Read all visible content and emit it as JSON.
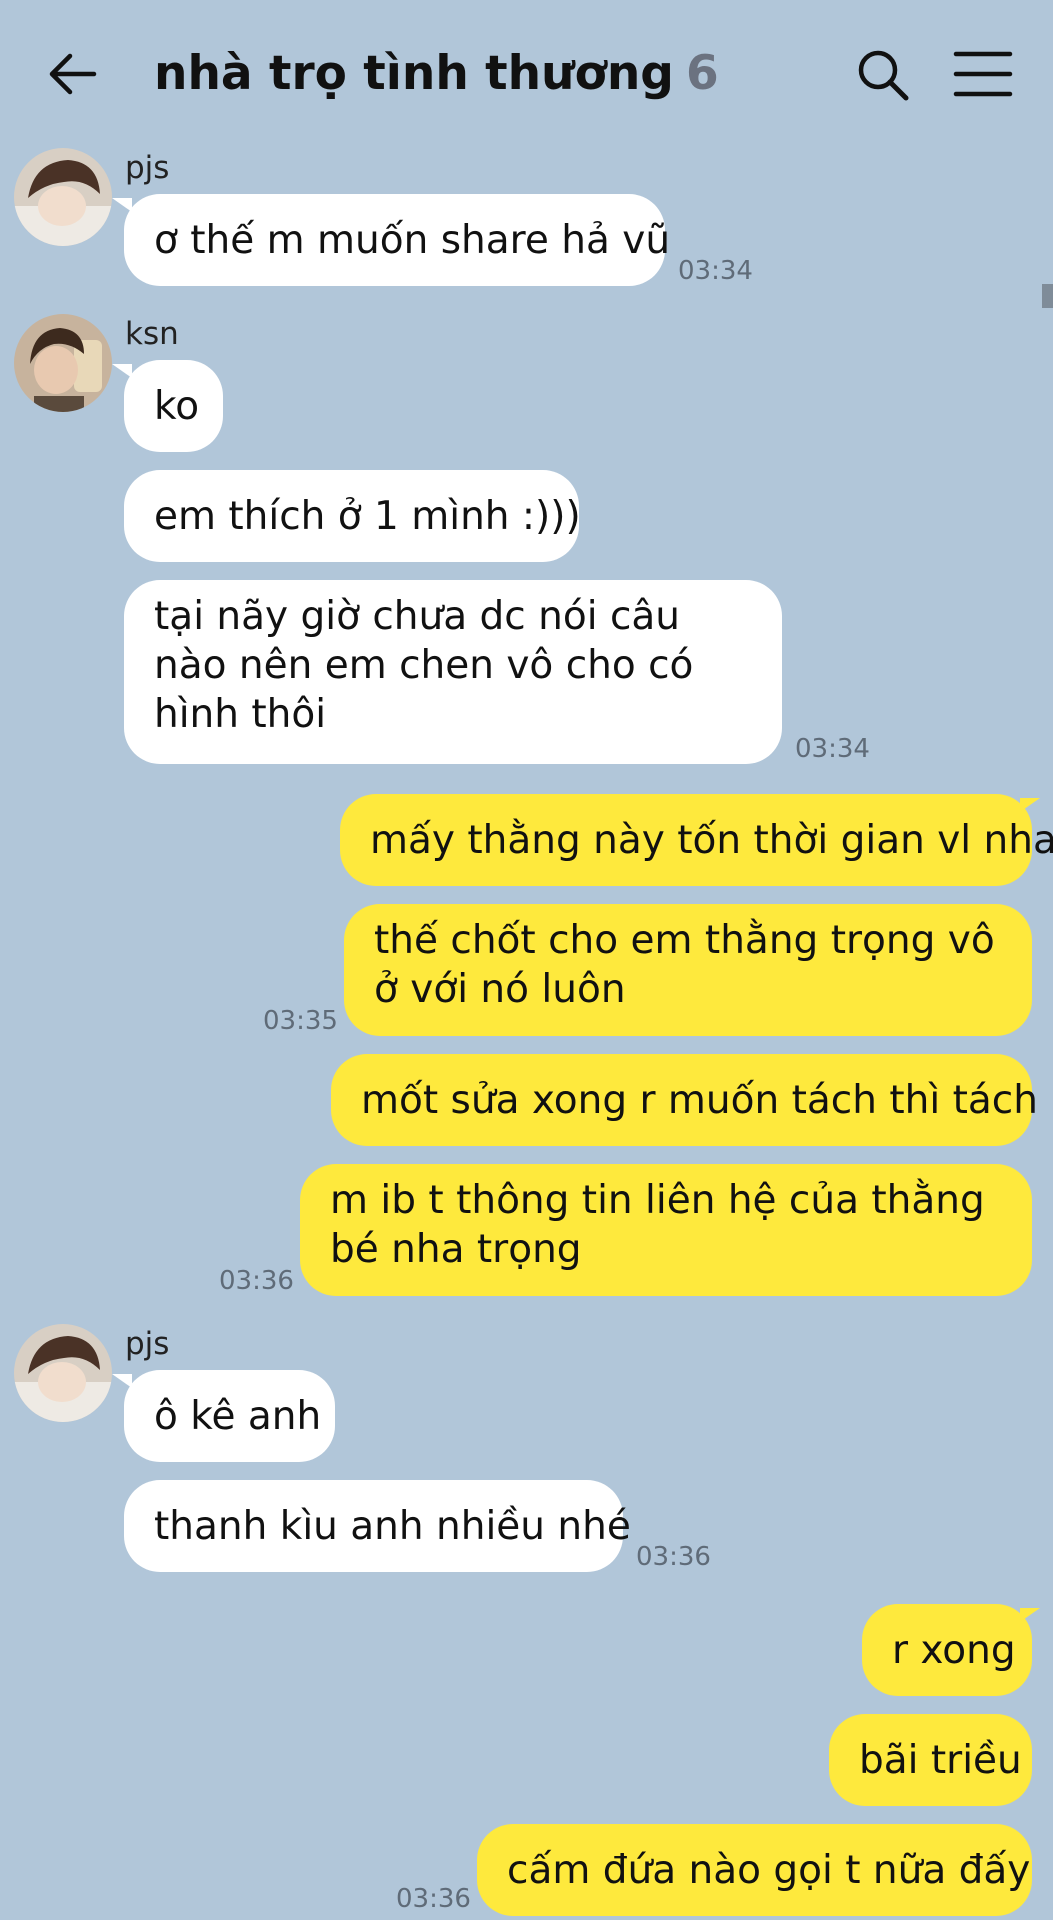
{
  "header": {
    "title": "nhà trọ tình thương",
    "member_count": "6",
    "back_icon": "arrow-left-icon",
    "search_icon": "search-icon",
    "menu_icon": "hamburger-menu-icon"
  },
  "messages": [
    {
      "sender": "pjs",
      "text": "ơ thế m muốn share hả vũ",
      "time": "03:34"
    },
    {
      "sender": "ksn",
      "text": "ko"
    },
    {
      "text": "em thích ở 1 mình :)))"
    },
    {
      "text": "tại nãy giờ chưa dc nói câu nào nên em chen vô cho có hình thôi",
      "time": "03:34"
    },
    {
      "text": "mấy thằng này tốn thời gian vl nha"
    },
    {
      "text": "thế chốt cho em thằng trọng vô ở với nó luôn",
      "time": "03:35"
    },
    {
      "text": "mốt sửa xong r muốn tách thì tách"
    },
    {
      "text": "m ib t thông tin liên hệ của thằng bé nha trọng",
      "time": "03:36"
    },
    {
      "sender": "pjs",
      "text": "ô kê anh"
    },
    {
      "text": "thanh kìu anh nhiều nhé",
      "time": "03:36"
    },
    {
      "text": "r xong"
    },
    {
      "text": "bãi triều"
    },
    {
      "text": "cấm đứa nào gọi t nữa đấy",
      "time": "03:36"
    }
  ],
  "colors": {
    "background": "#b1c6d9",
    "incoming_bubble": "#ffffff",
    "outgoing_bubble": "#fee93d"
  }
}
